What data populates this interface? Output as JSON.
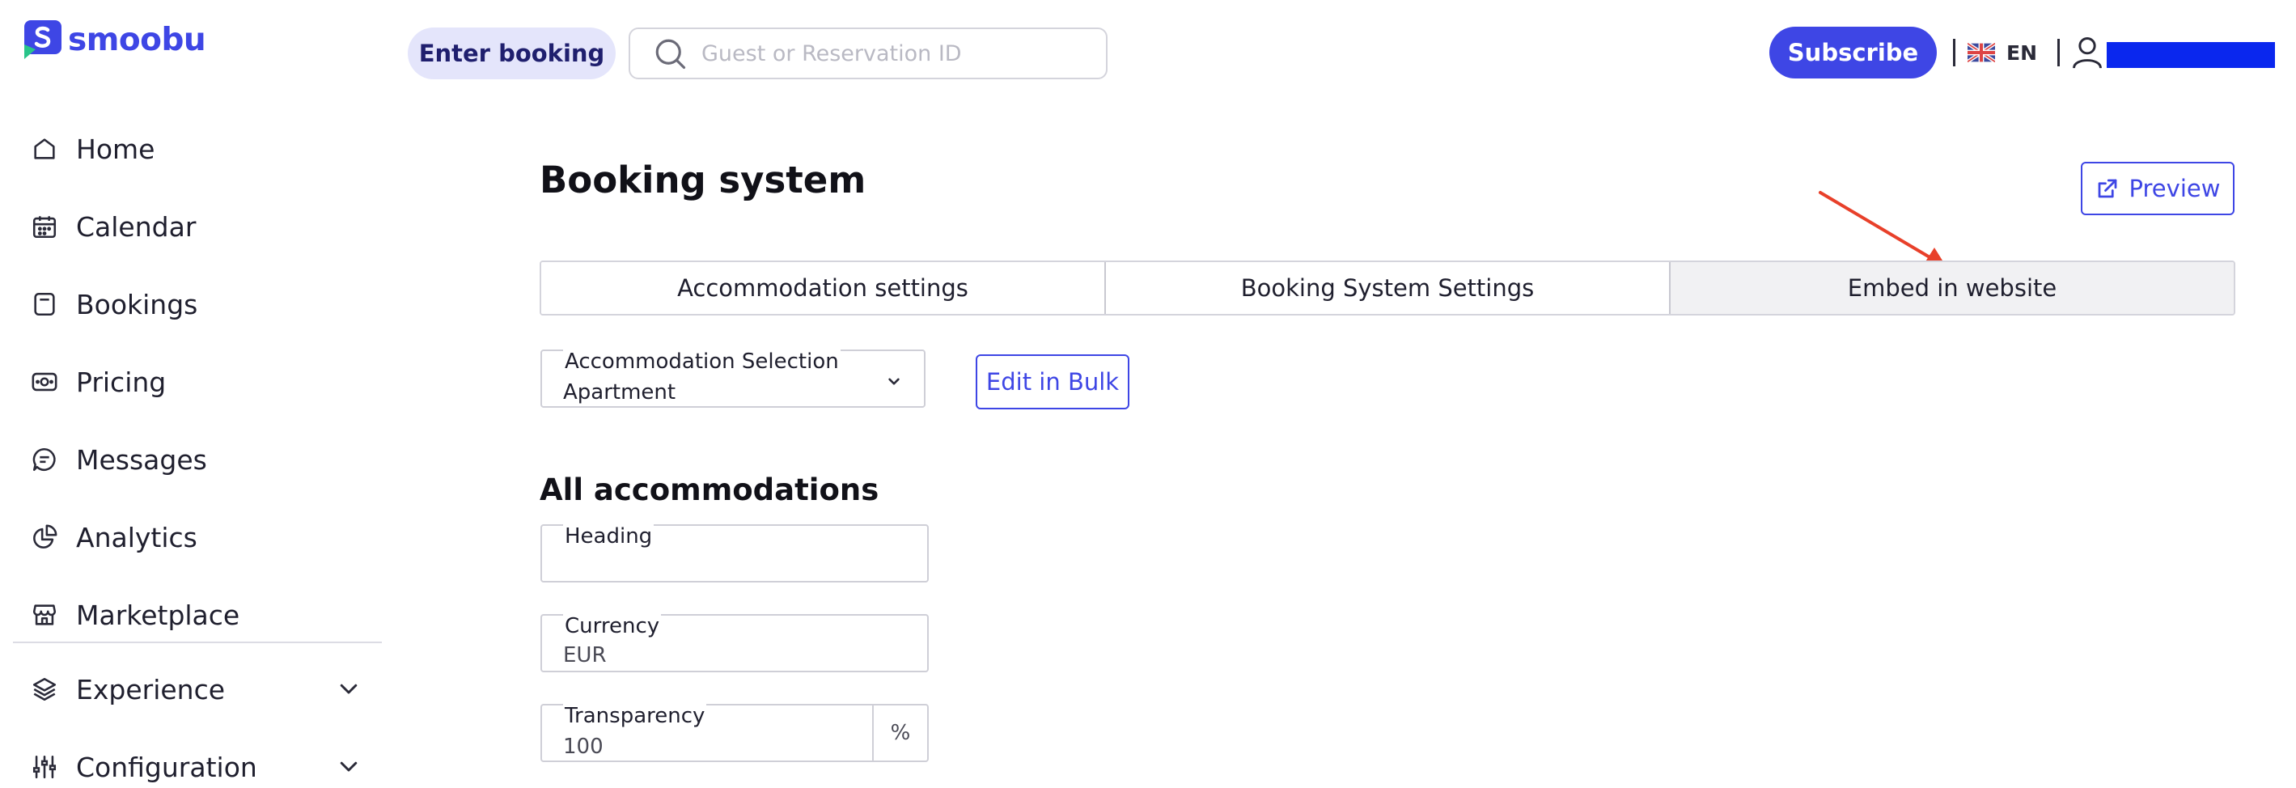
{
  "app": {
    "brand": "smoobu",
    "brand_color": "#3e46e5"
  },
  "sidebar": {
    "items": [
      {
        "label": "Home",
        "icon": "home-icon"
      },
      {
        "label": "Calendar",
        "icon": "calendar-icon"
      },
      {
        "label": "Bookings",
        "icon": "bookings-icon"
      },
      {
        "label": "Pricing",
        "icon": "pricing-icon"
      },
      {
        "label": "Messages",
        "icon": "messages-icon"
      },
      {
        "label": "Analytics",
        "icon": "analytics-icon"
      },
      {
        "label": "Marketplace",
        "icon": "marketplace-icon"
      }
    ],
    "groups": [
      {
        "label": "Experience",
        "icon": "layers-icon",
        "expand_icon": "chevron-down-icon"
      },
      {
        "label": "Configuration",
        "icon": "sliders-icon",
        "expand_icon": "chevron-down-icon"
      }
    ]
  },
  "topbar": {
    "enter_booking_label": "Enter booking",
    "search_placeholder": "Guest or Reservation ID",
    "search_value": "",
    "subscribe_label": "Subscribe",
    "language": "EN",
    "user_name_redacted_color": "#0a27ee"
  },
  "main": {
    "title": "Booking system",
    "preview_label": "Preview",
    "tabs": [
      {
        "label": "Accommodation settings",
        "active": false
      },
      {
        "label": "Booking System Settings",
        "active": false
      },
      {
        "label": "Embed in website",
        "active": true
      }
    ],
    "accommodation_select": {
      "label": "Accommodation Selection",
      "value": "Apartment"
    },
    "edit_bulk_label": "Edit in Bulk",
    "section_title": "All accommodations",
    "fields": {
      "heading": {
        "label": "Heading",
        "value": ""
      },
      "currency": {
        "label": "Currency",
        "value": "EUR"
      },
      "transparency": {
        "label": "Transparency",
        "value": "100",
        "suffix": "%"
      }
    },
    "annotation_arrow_color": "#e8402a"
  }
}
